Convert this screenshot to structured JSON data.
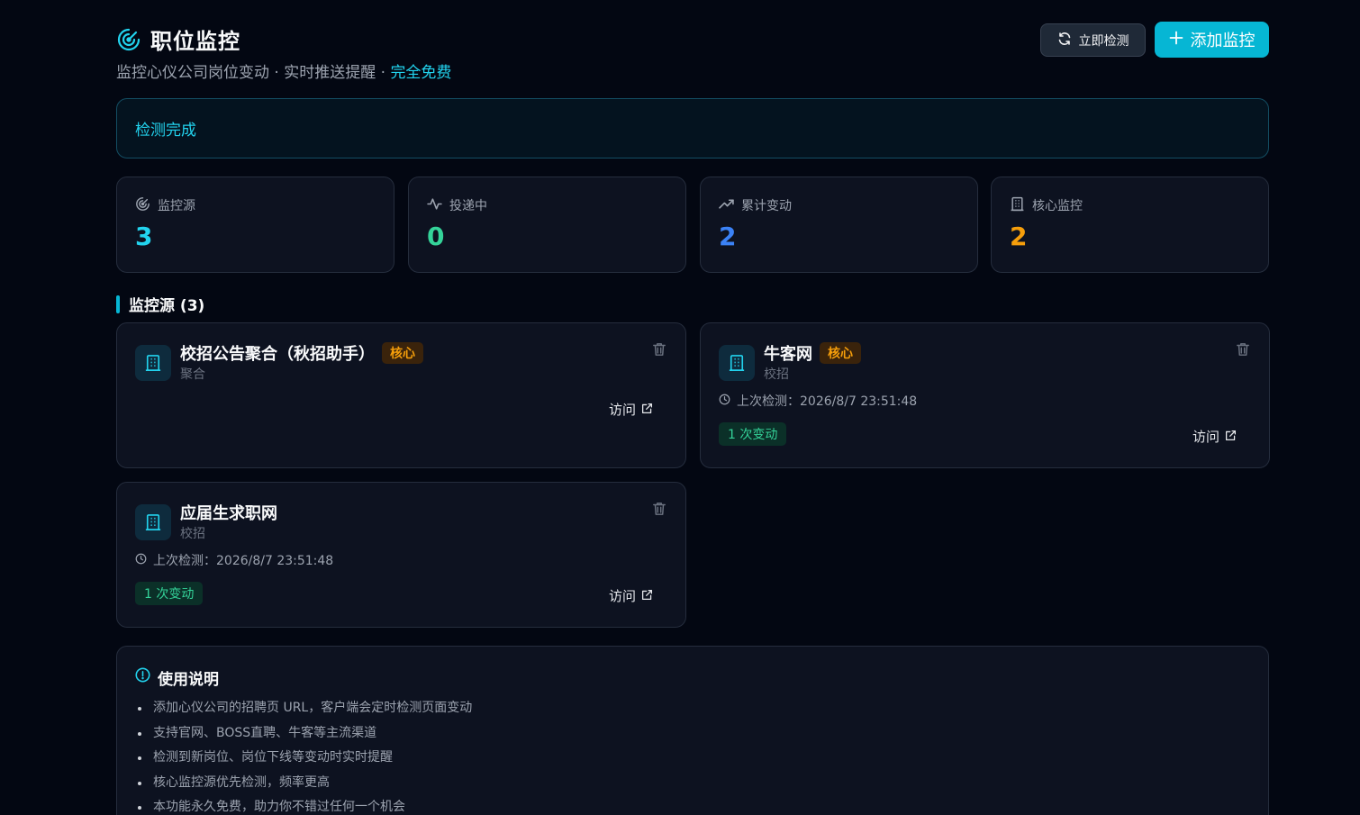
{
  "header": {
    "title": "职位监控",
    "subtitle_main": "监控心仪公司岗位变动 · 实时推送提醒 · ",
    "subtitle_free": "完全免费",
    "check_button": "立即检测",
    "add_button": "添加监控"
  },
  "status": {
    "message": "检测完成"
  },
  "stats": [
    {
      "label": "监控源",
      "value": "3",
      "icon": "radar-icon",
      "color": "#22d3ee"
    },
    {
      "label": "投递中",
      "value": "0",
      "icon": "activity-icon",
      "color": "#34d399"
    },
    {
      "label": "累计变动",
      "value": "2",
      "icon": "trending-up-icon",
      "color": "#3b82f6"
    },
    {
      "label": "核心监控",
      "value": "2",
      "icon": "building-icon",
      "color": "#f59e0b"
    }
  ],
  "section": {
    "title": "监控源 (3)"
  },
  "sources": [
    {
      "name": "校招公告聚合（秋招助手）",
      "badge": "核心",
      "category": "聚合",
      "visit": "访问"
    },
    {
      "name": "牛客网",
      "badge": "核心",
      "category": "校招",
      "last_check": "上次检测：2026/8/7 23:51:48",
      "changes": "1 次变动",
      "visit": "访问"
    },
    {
      "name": "应届生求职网",
      "category": "校招",
      "last_check": "上次检测：2026/8/7 23:51:48",
      "changes": "1 次变动",
      "visit": "访问"
    }
  ],
  "usage": {
    "title": "使用说明",
    "items": [
      "添加心仪公司的招聘页 URL，客户端会定时检测页面变动",
      "支持官网、BOSS直聘、牛客等主流渠道",
      "检测到新岗位、岗位下线等变动时实时提醒",
      "核心监控源优先检测，频率更高",
      "本功能永久免费，助力你不错过任何一个机会"
    ]
  },
  "colors": {
    "background": "#030712",
    "accent": "#06b6d4",
    "card": "#0d1220",
    "core_badge": "#f59e0b",
    "change_badge": "#34d399"
  }
}
